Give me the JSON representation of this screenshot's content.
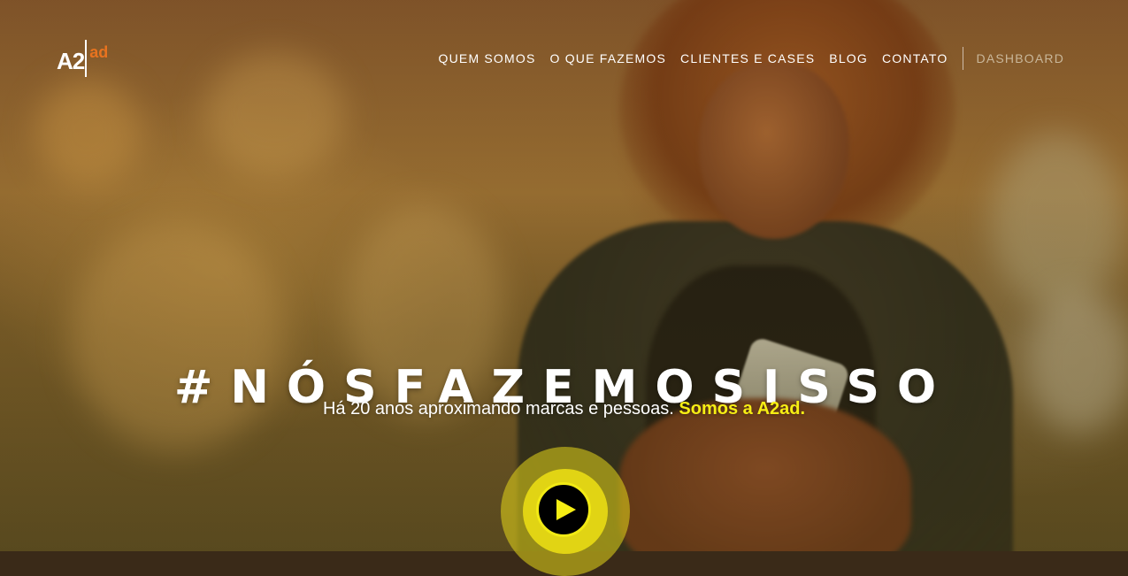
{
  "header": {
    "logo": {
      "main": "A2",
      "sub": "ad"
    },
    "nav": {
      "items": [
        {
          "label": "QUEM SOMOS"
        },
        {
          "label": "O QUE FAZEMOS"
        },
        {
          "label": "CLIENTES E CASES"
        },
        {
          "label": "BLOG"
        },
        {
          "label": "CONTATO"
        }
      ],
      "dashboard_label": "DASHBOARD"
    }
  },
  "hero": {
    "headline": "#NÓSFAZEMOSISSO",
    "subline_text": "Há 20 anos aproximando marcas e pessoas.",
    "subline_highlight": "Somos a A2ad.",
    "play_icon": "play-icon"
  },
  "colors": {
    "accent_yellow": "#f6ee14",
    "logo_orange": "#e8731f",
    "text_white": "#ffffff",
    "dashboard_muted": "#c9b79a"
  }
}
